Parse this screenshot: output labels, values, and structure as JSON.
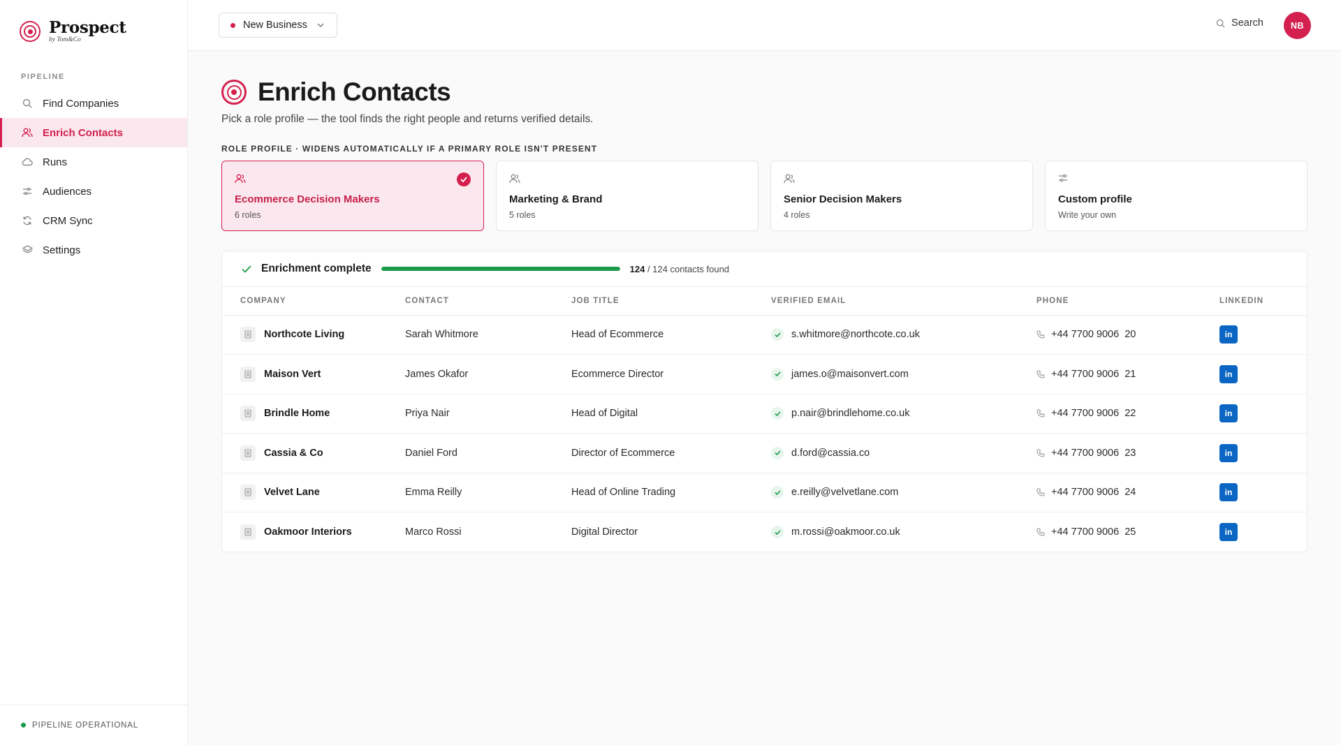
{
  "brand": {
    "name": "Prospect",
    "byline": "by Tom&Co"
  },
  "sidebar": {
    "section_label": "PIPELINE",
    "items": [
      {
        "label": "Find Companies",
        "icon": "search-icon"
      },
      {
        "label": "Enrich Contacts",
        "icon": "users-icon",
        "active": true
      },
      {
        "label": "Runs",
        "icon": "cloud-icon"
      },
      {
        "label": "Audiences",
        "icon": "sliders-icon"
      },
      {
        "label": "CRM Sync",
        "icon": "sync-icon"
      },
      {
        "label": "Settings",
        "icon": "layers-icon"
      }
    ],
    "footer_status": "PIPELINE OPERATIONAL"
  },
  "topbar": {
    "workspace": "New Business",
    "search_label": "Search",
    "avatar_initials": "NB"
  },
  "page": {
    "title": "Enrich Contacts",
    "subtitle": "Pick a role profile — the tool finds the right people and returns verified details.",
    "role_label": "ROLE PROFILE · WIDENS AUTOMATICALLY IF A PRIMARY ROLE ISN'T PRESENT"
  },
  "role_cards": [
    {
      "title": "Ecommerce Decision Makers",
      "sub": "6 roles",
      "selected": true,
      "icon": "users-icon"
    },
    {
      "title": "Marketing & Brand",
      "sub": "5 roles",
      "selected": false,
      "icon": "users-icon"
    },
    {
      "title": "Senior Decision Makers",
      "sub": "4 roles",
      "selected": false,
      "icon": "users-icon"
    },
    {
      "title": "Custom profile",
      "sub": "Write your own",
      "selected": false,
      "icon": "sliders-icon"
    }
  ],
  "progress": {
    "label": "Enrichment complete",
    "found": "124",
    "total_text": " / 124 contacts found",
    "fraction": 1.0
  },
  "table": {
    "headers": [
      "COMPANY",
      "CONTACT",
      "JOB TITLE",
      "VERIFIED EMAIL",
      "PHONE",
      "LINKEDIN"
    ],
    "rows": [
      {
        "company": "Northcote Living",
        "contact": "Sarah Whitmore",
        "job": "Head of Ecommerce",
        "email": "s.whitmore@northcote.co.uk",
        "phone": "+44 7700 9006  20",
        "linkedin": "in"
      },
      {
        "company": "Maison Vert",
        "contact": "James Okafor",
        "job": "Ecommerce Director",
        "email": "james.o@maisonvert.com",
        "phone": "+44 7700 9006  21",
        "linkedin": "in"
      },
      {
        "company": "Brindle Home",
        "contact": "Priya Nair",
        "job": "Head of Digital",
        "email": "p.nair@brindlehome.co.uk",
        "phone": "+44 7700 9006  22",
        "linkedin": "in"
      },
      {
        "company": "Cassia & Co",
        "contact": "Daniel Ford",
        "job": "Director of Ecommerce",
        "email": "d.ford@cassia.co",
        "phone": "+44 7700 9006  23",
        "linkedin": "in"
      },
      {
        "company": "Velvet Lane",
        "contact": "Emma Reilly",
        "job": "Head of Online Trading",
        "email": "e.reilly@velvetlane.com",
        "phone": "+44 7700 9006  24",
        "linkedin": "in"
      },
      {
        "company": "Oakmoor Interiors",
        "contact": "Marco Rossi",
        "job": "Digital Director",
        "email": "m.rossi@oakmoor.co.uk",
        "phone": "+44 7700 9006  25",
        "linkedin": "in"
      }
    ]
  },
  "colors": {
    "accent": "#d4204f",
    "success": "#1b9a4b",
    "linkedin": "#0a66c2"
  }
}
